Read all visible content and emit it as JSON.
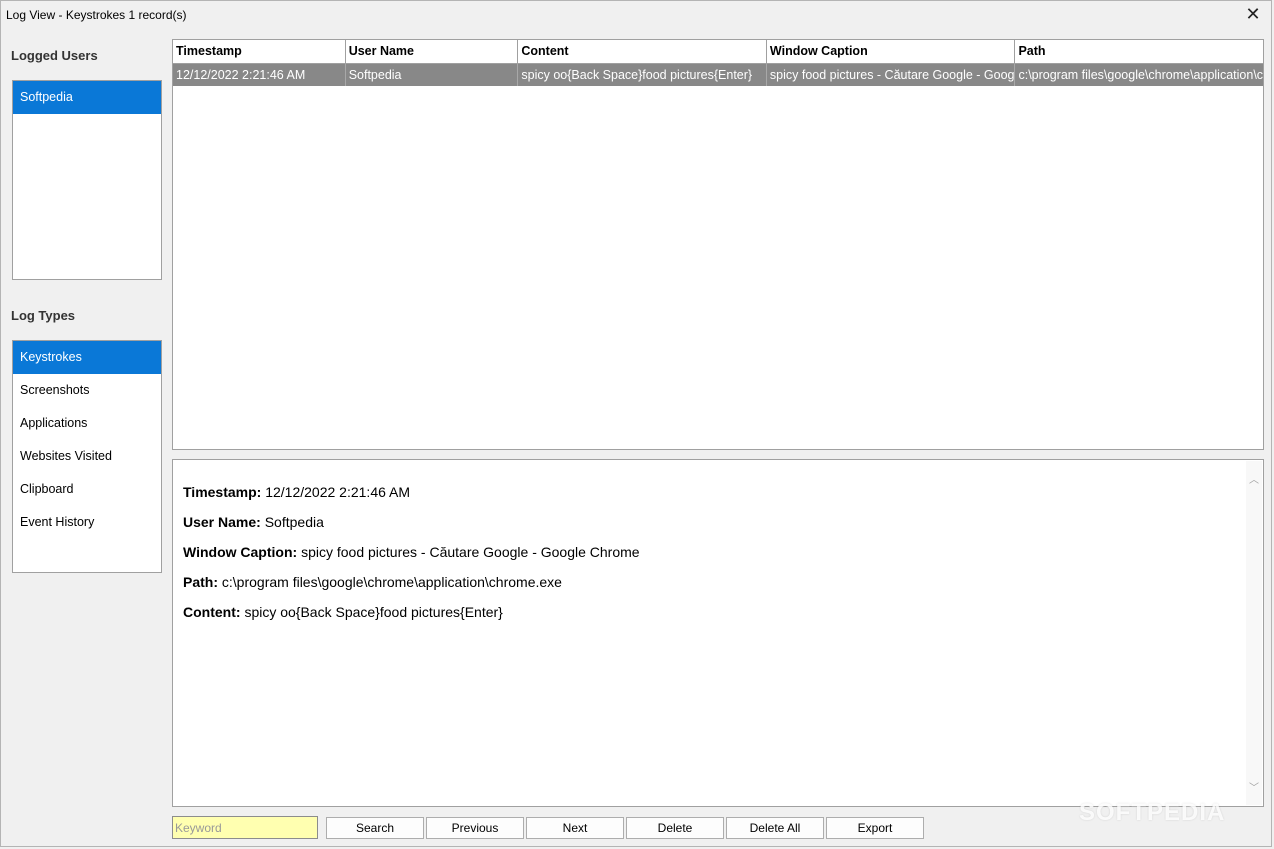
{
  "window": {
    "title": "Log View -  Keystrokes 1 record(s)",
    "close_glyph": "✕"
  },
  "sidebar": {
    "users_label": "Logged Users",
    "users": [
      {
        "label": "Softpedia",
        "selected": true
      }
    ],
    "types_label": "Log Types",
    "types": [
      {
        "label": "Keystrokes",
        "selected": true
      },
      {
        "label": "Screenshots",
        "selected": false
      },
      {
        "label": "Applications",
        "selected": false
      },
      {
        "label": "Websites Visited",
        "selected": false
      },
      {
        "label": "Clipboard",
        "selected": false
      },
      {
        "label": "Event History",
        "selected": false
      }
    ]
  },
  "grid": {
    "columns": [
      "Timestamp",
      "User Name",
      "Content",
      "Window Caption",
      "Path"
    ],
    "rows": [
      [
        "12/12/2022 2:21:46 AM",
        "Softpedia",
        "spicy oo{Back Space}food pictures{Enter}",
        "spicy food pictures - Căutare Google - Google Chrome",
        "c:\\program files\\google\\chrome\\application\\chrome.exe"
      ]
    ],
    "selected_row_color": "#888888"
  },
  "detail": {
    "timestamp_label": "Timestamp:",
    "timestamp_value": "12/12/2022 2:21:46 AM",
    "username_label": "User Name:",
    "username_value": "Softpedia",
    "caption_label": "Window Caption:",
    "caption_value": "spicy food pictures - Căutare Google - Google Chrome",
    "path_label": "Path:",
    "path_value": "c:\\program files\\google\\chrome\\application\\chrome.exe",
    "content_label": "Content:",
    "content_value": "spicy oo{Back Space}food pictures{Enter}",
    "scroll_up_glyph": "︿",
    "scroll_down_glyph": "﹀"
  },
  "toolbar": {
    "keyword_placeholder": "Keyword",
    "keyword_value": "",
    "search": "Search",
    "previous": "Previous",
    "next": "Next",
    "delete": "Delete",
    "delete_all": "Delete All",
    "export": "Export"
  },
  "watermark": "SOFTPEDIA",
  "colors": {
    "selection": "#0a78d7",
    "keyword_bg": "#ffffb0",
    "background": "#f0f0f0"
  }
}
